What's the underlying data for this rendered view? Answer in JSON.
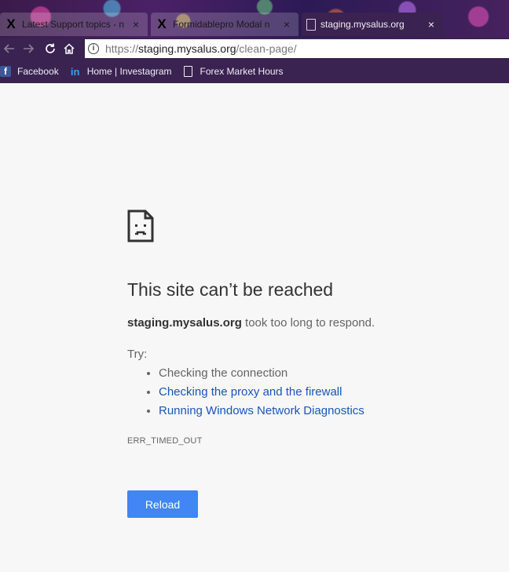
{
  "tabs": [
    {
      "title": "Latest Support topics - n",
      "favicon": "x-icon",
      "active": false
    },
    {
      "title": "Formidablepro Modal n",
      "favicon": "x-icon",
      "active": false
    },
    {
      "title": "staging.mysalus.org",
      "favicon": "document-icon",
      "active": true
    }
  ],
  "tab_close_glyph": "×",
  "x_glyph": "X",
  "address_bar": {
    "scheme": "https://",
    "host": "staging.mysalus.org",
    "path": "/clean-page/",
    "info_glyph": "i"
  },
  "bookmarks": [
    {
      "label": "Facebook",
      "icon": "facebook-icon",
      "glyph": "f"
    },
    {
      "label": "Home | Investagram",
      "icon": "investagram-icon",
      "glyph": "in"
    },
    {
      "label": "Forex Market Hours",
      "icon": "document-icon",
      "glyph": ""
    }
  ],
  "error_page": {
    "title": "This site can’t be reached",
    "host": "staging.mysalus.org",
    "description_suffix": " took too long to respond.",
    "try_label": "Try:",
    "suggestions": [
      {
        "text": "Checking the connection",
        "link": false
      },
      {
        "text": "Checking the proxy and the firewall",
        "link": true
      },
      {
        "text": "Running Windows Network Diagnostics",
        "link": true
      }
    ],
    "error_code": "ERR_TIMED_OUT",
    "reload_label": "Reload"
  },
  "colors": {
    "reload_button": "#4285f4",
    "link": "#1a56b8",
    "page_background": "#f7f7f7",
    "chrome_frame": "#3a2350"
  }
}
